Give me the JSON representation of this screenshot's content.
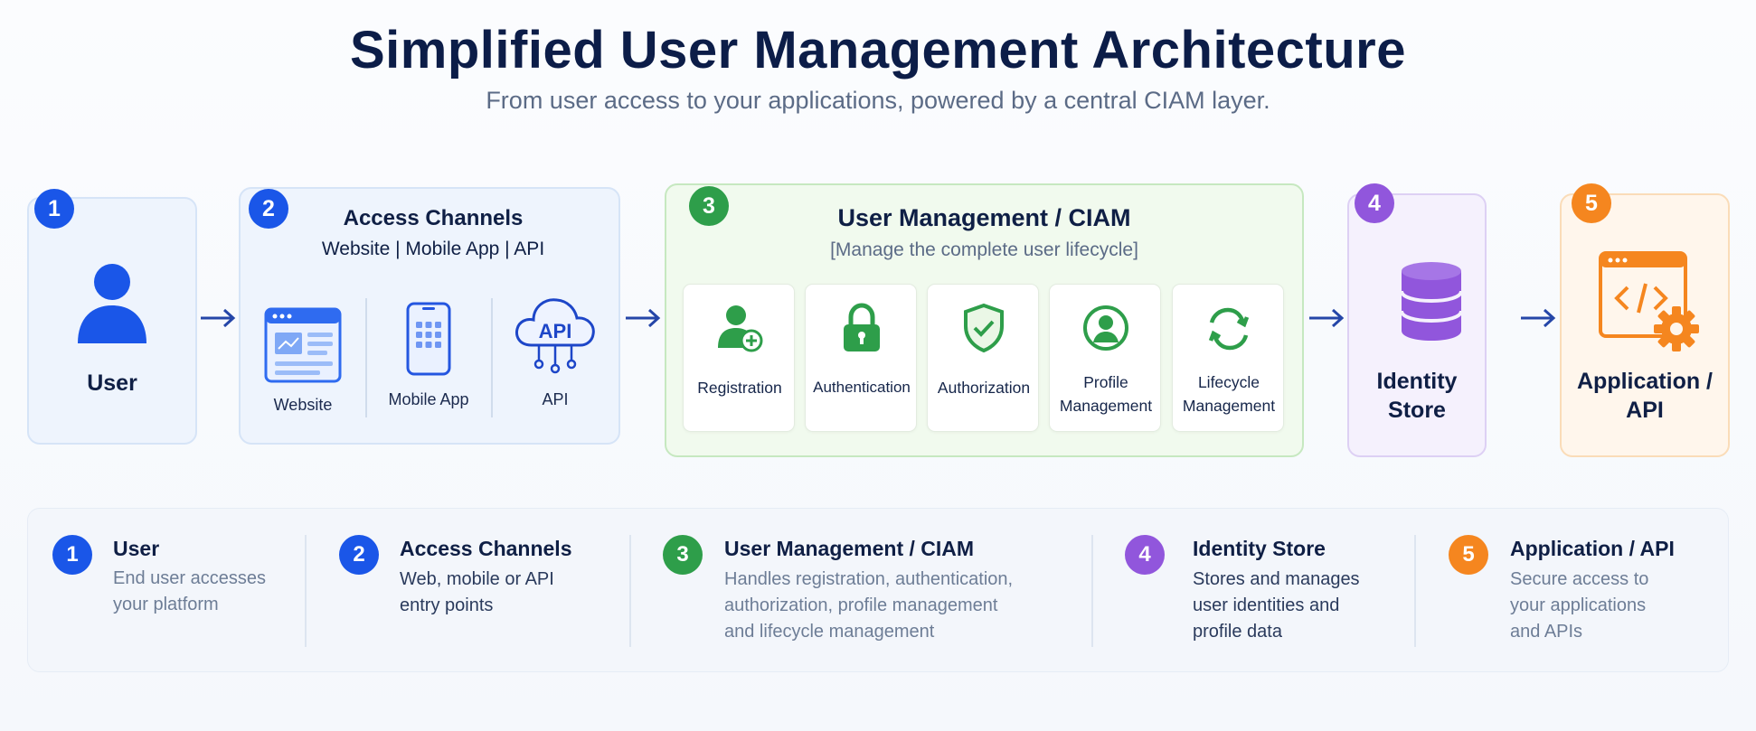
{
  "header": {
    "title": "Simplified User Management Architecture",
    "subtitle": "From user access to your applications, powered by a central CIAM layer."
  },
  "colors": {
    "blue": "#1a56e8",
    "green": "#2e9e4a",
    "purple": "#9156dc",
    "orange": "#f5861f",
    "arrow": "#2546a8"
  },
  "flow": {
    "user": {
      "number": "1",
      "label": "User"
    },
    "access": {
      "number": "2",
      "title": "Access Channels",
      "subtitle": "Website | Mobile App | API",
      "channels": [
        {
          "label": "Website",
          "icon": "website-icon"
        },
        {
          "label": "Mobile App",
          "icon": "mobile-phone-icon"
        },
        {
          "label": "API",
          "icon": "api-cloud-icon",
          "icon_text": "API"
        }
      ]
    },
    "ciam": {
      "number": "3",
      "title": "User Management / CIAM",
      "note": "[Manage the complete user lifecycle]",
      "functions": [
        {
          "line1": "Registration",
          "line2": "",
          "icon": "add-user-icon"
        },
        {
          "line1": "Authentication",
          "line2": "",
          "icon": "padlock-icon"
        },
        {
          "line1": "Authorization",
          "line2": "",
          "icon": "shield-check-icon"
        },
        {
          "line1": "Profile",
          "line2": "Management",
          "icon": "profile-circle-icon"
        },
        {
          "line1": "Lifecycle",
          "line2": "Management",
          "icon": "refresh-cycle-icon"
        }
      ]
    },
    "store": {
      "number": "4",
      "line1": "Identity",
      "line2": "Store",
      "icon": "database-icon"
    },
    "app": {
      "number": "5",
      "line1": "Application /",
      "line2": "API",
      "icon": "app-code-gear-icon"
    }
  },
  "legend": [
    {
      "number": "1",
      "title": "User",
      "desc": "End user accesses\nyour platform"
    },
    {
      "number": "2",
      "title": "Access Channels",
      "desc": "Web, mobile or API\nentry points"
    },
    {
      "number": "3",
      "title": "User Management / CIAM",
      "desc": "Handles registration, authentication,\nauthorization, profile management\nand lifecycle management"
    },
    {
      "number": "4",
      "title": "Identity Store",
      "desc": "Stores and manages\nuser identities and\nprofile data"
    },
    {
      "number": "5",
      "title": "Application / API",
      "desc": "Secure access to\nyour applications\nand APIs"
    }
  ]
}
